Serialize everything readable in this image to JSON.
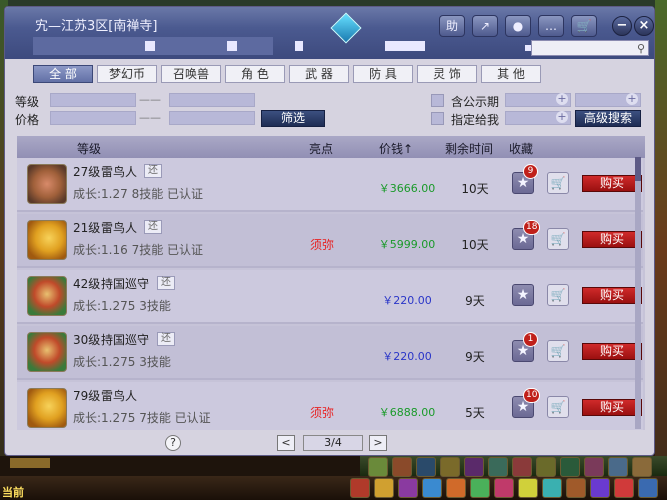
{
  "window": {
    "title": "宄—江苏3区[南禅寺]",
    "toolbar": [
      "助",
      "↗",
      "●",
      "…",
      "🛒"
    ],
    "controls": {
      "minimize": "−",
      "close": "×"
    },
    "search_icon": "search-icon"
  },
  "tabs": [
    {
      "label": "全 部",
      "active": true
    },
    {
      "label": "梦幻币",
      "active": false
    },
    {
      "label": "召唤兽",
      "active": false
    },
    {
      "label": "角 色",
      "active": false
    },
    {
      "label": "武 器",
      "active": false
    },
    {
      "label": "防 具",
      "active": false
    },
    {
      "label": "灵 饰",
      "active": false
    },
    {
      "label": "其 他",
      "active": false
    }
  ],
  "filters": {
    "level_label": "等级",
    "price_label": "价格",
    "dash": "——",
    "filter_button": "筛选",
    "public_period_label": "含公示期",
    "designated_label": "指定给我",
    "advanced_button": "高级搜索",
    "plus": "+"
  },
  "table": {
    "headers": {
      "level": "等级",
      "highlight": "亮点",
      "price": "价钱↑",
      "remaining": "剩余时间",
      "favorite": "收藏"
    },
    "buy_label": "购买",
    "rows": [
      {
        "level": "27级",
        "name": "雷鸟人",
        "badge": "还",
        "sub": "成长:1.27  8技能  已认证",
        "highlight": "",
        "price": "￥3666.00",
        "price_color": "green",
        "days": "10天",
        "fav_count": "9",
        "avatar": "beast"
      },
      {
        "level": "21级",
        "name": "雷鸟人",
        "badge": "还",
        "sub": "成长:1.16  7技能  已认证",
        "highlight": "须弥",
        "price": "￥5999.00",
        "price_color": "green",
        "days": "10天",
        "fav_count": "18",
        "avatar": "bird"
      },
      {
        "level": "42级",
        "name": "持国巡守",
        "badge": "还",
        "sub": "成长:1.275  3技能",
        "highlight": "",
        "price": "￥220.00",
        "price_color": "blue",
        "days": "9天",
        "fav_count": "",
        "avatar": "guard"
      },
      {
        "level": "30级",
        "name": "持国巡守",
        "badge": "还",
        "sub": "成长:1.275  3技能",
        "highlight": "",
        "price": "￥220.00",
        "price_color": "blue",
        "days": "9天",
        "fav_count": "1",
        "avatar": "guard"
      },
      {
        "level": "79级",
        "name": "雷鸟人",
        "badge": "",
        "sub": "成长:1.275  7技能  已认证",
        "highlight": "须弥",
        "price": "￥6888.00",
        "price_color": "green",
        "days": "5天",
        "fav_count": "10",
        "avatar": "bird"
      }
    ]
  },
  "footer": {
    "help": "?",
    "prev": "<",
    "next": ">",
    "page": "3/4"
  },
  "gamebar": {
    "now_label": "当前"
  },
  "colors": {
    "accent": "#4b5a90",
    "buy": "#c0201a",
    "price_green": "#1a9a2a",
    "price_blue": "#2a36c8",
    "highlight_red": "#e82020"
  }
}
